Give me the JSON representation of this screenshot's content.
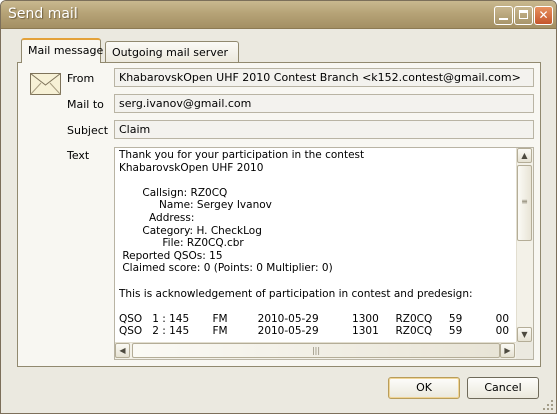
{
  "window": {
    "title": "Send mail",
    "controls": {
      "minimize_icon": "minimize-icon",
      "maximize_icon": "maximize-icon",
      "close_glyph": "✕"
    }
  },
  "tabs": [
    {
      "label": "Mail message",
      "active": true
    },
    {
      "label": "Outgoing mail server",
      "active": false
    }
  ],
  "form": {
    "icon": "envelope-icon",
    "from_label": "From",
    "from_value": "KhabarovskOpen UHF 2010 Contest Branch <k152.contest@gmail.com>",
    "to_label": "Mail to",
    "to_value": "serg.ivanov@gmail.com",
    "subject_label": "Subject",
    "subject_value": "Claim",
    "text_label": "Text",
    "text_value": "Thank you for your participation in the contest\nKhabarovskOpen UHF 2010\n\n       Callsign: RZ0CQ\n            Name: Sergey Ivanov\n         Address:\n       Category: H. CheckLog\n             File: RZ0CQ.cbr\n Reported QSOs: 15\n Claimed score: 0 (Points: 0 Multiplier: 0)\n\nThis is acknowledgement of participation in contest and predesign:\n\nQSO   1 : 145       FM         2010-05-29          1300     RZ0CQ     59          00\nQSO   2 : 145       FM         2010-05-29          1301     RZ0CQ     59          00"
  },
  "scrollbars": {
    "up_glyph": "▲",
    "down_glyph": "▼",
    "left_glyph": "◀",
    "right_glyph": "▶",
    "grip_v": "≡",
    "grip_h": "|||"
  },
  "buttons": {
    "ok": "OK",
    "cancel": "Cancel"
  },
  "colors": {
    "titlebar": "#b6a377",
    "window_bg": "#ebe9e0",
    "tab_accent": "#e4a23a"
  }
}
